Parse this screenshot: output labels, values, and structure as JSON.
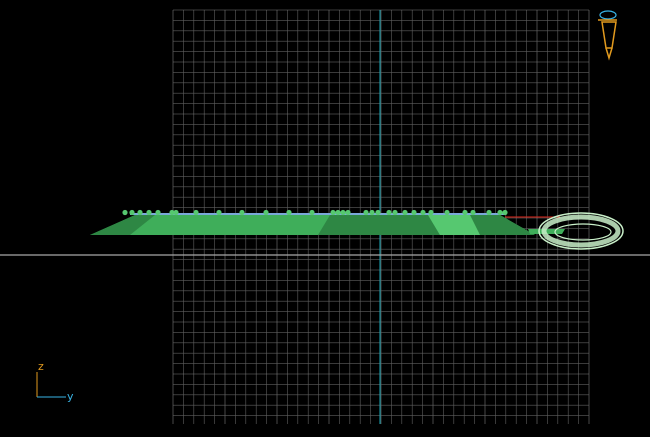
{
  "viewport": {
    "view": "side",
    "background": "#000000",
    "grid_color": "#5f5f5f",
    "grid_major_color": "#7a7a7a",
    "horizon_color": "#a8a8a8",
    "vertical_axis_color": "#1aa9b8",
    "red_axis_color": "#e0261a"
  },
  "axis_gizmo": {
    "vertical_label": "z",
    "horizontal_label": "y",
    "vertical_color": "#e29a1e",
    "horizontal_color": "#39b4e6"
  },
  "camera_icon": {
    "icon": "camera-icon",
    "color": "#e29a1e",
    "accent": "#39b4e6"
  },
  "scene": {
    "ground_color": "#3fae5a",
    "ground_dark": "#2e8744",
    "ground_light": "#56c870",
    "water_color": "#7aa8d8",
    "ring_color": "#c9f0c9"
  }
}
